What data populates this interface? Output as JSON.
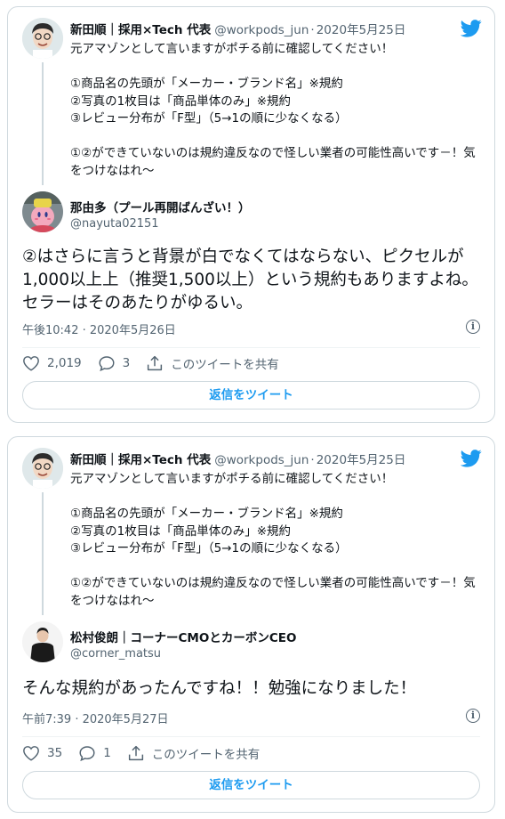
{
  "tweets": [
    {
      "parent": {
        "name": "新田順｜採用×Tech 代表",
        "handle": "@workpods_jun",
        "dot": "·",
        "date": "2020年5月25日",
        "text": "元アマゾンとして言いますがポチる前に確認してください！\n\n①商品名の先頭が「メーカー・ブランド名」※規約\n②写真の1枚目は「商品単体のみ」※規約\n③レビュー分布が「F型」（5→1の順に少なくなる）\n\n①②ができていないのは規約違反なので怪しい業者の可能性高いです－！気をつけなはれ〜"
      },
      "reply": {
        "name": "那由多（プール再開ばんざい！）",
        "handle": "@nayuta02151",
        "text": "②はさらに言うと背景が白でなくてはならない、ピクセルが1,000以上上（推奨1,500以上）という規約もありますよね。セラーはそのあたりがゆるい。",
        "time": "午後10:42 · 2020年5月26日"
      },
      "actions": {
        "likes": "2,019",
        "comments": "3",
        "share": "このツイートを共有"
      },
      "reply_button": "返信をツイート"
    },
    {
      "parent": {
        "name": "新田順｜採用×Tech 代表",
        "handle": "@workpods_jun",
        "dot": "·",
        "date": "2020年5月25日",
        "text": "元アマゾンとして言いますがポチる前に確認してください！\n\n①商品名の先頭が「メーカー・ブランド名」※規約\n②写真の1枚目は「商品単体のみ」※規約\n③レビュー分布が「F型」（5→1の順に少なくなる）\n\n①②ができていないのは規約違反なので怪しい業者の可能性高いです－！気をつけなはれ〜"
      },
      "reply": {
        "name": "松村俊朗｜コーナーCMOとカーボンCEO",
        "handle": "@corner_matsu",
        "text": "そんな規約があったんですね！！勉強になりました！",
        "time": "午前7:39 · 2020年5月27日"
      },
      "actions": {
        "likes": "35",
        "comments": "1",
        "share": "このツイートを共有"
      },
      "reply_button": "返信をツイート"
    }
  ],
  "colors": {
    "accent": "#1d9bf0",
    "secondary_text": "#536471",
    "border": "#cfd9de"
  },
  "icons": [
    "twitter-bird-icon",
    "heart-icon",
    "comment-icon",
    "share-icon",
    "info-icon"
  ]
}
